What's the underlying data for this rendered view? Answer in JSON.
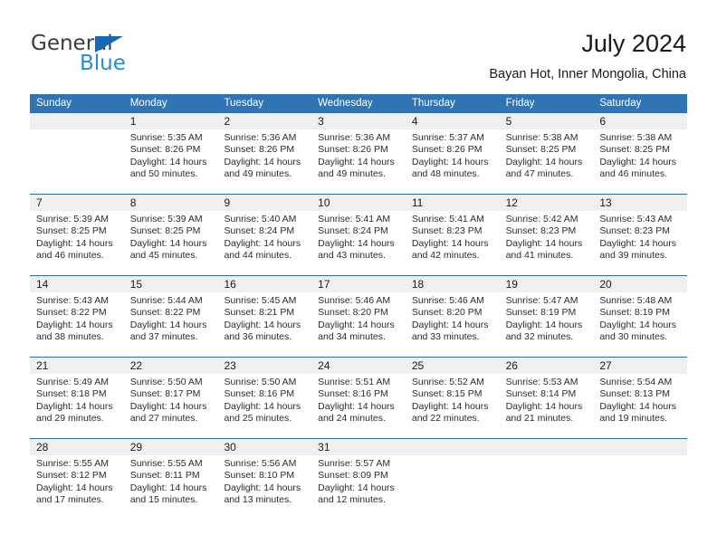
{
  "brand": {
    "name_part1": "General",
    "name_part2": "Blue",
    "triangle_color": "#1667b5",
    "blue_color": "#2a8ad4"
  },
  "header": {
    "title": "July 2024",
    "subtitle": "Bayan Hot, Inner Mongolia, China"
  },
  "theme": {
    "header_blue": "#3174b4",
    "separator_blue": "#2e6da4",
    "number_band_gray": "#efefef"
  },
  "calendar": {
    "weekday_headers": [
      "Sunday",
      "Monday",
      "Tuesday",
      "Wednesday",
      "Thursday",
      "Friday",
      "Saturday"
    ],
    "weeks": [
      {
        "days": [
          {
            "number": "",
            "sunrise": "",
            "sunset": "",
            "daylight_line1": "",
            "daylight_line2": "",
            "empty": true
          },
          {
            "number": "1",
            "sunrise": "Sunrise: 5:35 AM",
            "sunset": "Sunset: 8:26 PM",
            "daylight_line1": "Daylight: 14 hours",
            "daylight_line2": "and 50 minutes.",
            "empty": false
          },
          {
            "number": "2",
            "sunrise": "Sunrise: 5:36 AM",
            "sunset": "Sunset: 8:26 PM",
            "daylight_line1": "Daylight: 14 hours",
            "daylight_line2": "and 49 minutes.",
            "empty": false
          },
          {
            "number": "3",
            "sunrise": "Sunrise: 5:36 AM",
            "sunset": "Sunset: 8:26 PM",
            "daylight_line1": "Daylight: 14 hours",
            "daylight_line2": "and 49 minutes.",
            "empty": false
          },
          {
            "number": "4",
            "sunrise": "Sunrise: 5:37 AM",
            "sunset": "Sunset: 8:26 PM",
            "daylight_line1": "Daylight: 14 hours",
            "daylight_line2": "and 48 minutes.",
            "empty": false
          },
          {
            "number": "5",
            "sunrise": "Sunrise: 5:38 AM",
            "sunset": "Sunset: 8:25 PM",
            "daylight_line1": "Daylight: 14 hours",
            "daylight_line2": "and 47 minutes.",
            "empty": false
          },
          {
            "number": "6",
            "sunrise": "Sunrise: 5:38 AM",
            "sunset": "Sunset: 8:25 PM",
            "daylight_line1": "Daylight: 14 hours",
            "daylight_line2": "and 46 minutes.",
            "empty": false
          }
        ]
      },
      {
        "days": [
          {
            "number": "7",
            "sunrise": "Sunrise: 5:39 AM",
            "sunset": "Sunset: 8:25 PM",
            "daylight_line1": "Daylight: 14 hours",
            "daylight_line2": "and 46 minutes.",
            "empty": false
          },
          {
            "number": "8",
            "sunrise": "Sunrise: 5:39 AM",
            "sunset": "Sunset: 8:25 PM",
            "daylight_line1": "Daylight: 14 hours",
            "daylight_line2": "and 45 minutes.",
            "empty": false
          },
          {
            "number": "9",
            "sunrise": "Sunrise: 5:40 AM",
            "sunset": "Sunset: 8:24 PM",
            "daylight_line1": "Daylight: 14 hours",
            "daylight_line2": "and 44 minutes.",
            "empty": false
          },
          {
            "number": "10",
            "sunrise": "Sunrise: 5:41 AM",
            "sunset": "Sunset: 8:24 PM",
            "daylight_line1": "Daylight: 14 hours",
            "daylight_line2": "and 43 minutes.",
            "empty": false
          },
          {
            "number": "11",
            "sunrise": "Sunrise: 5:41 AM",
            "sunset": "Sunset: 8:23 PM",
            "daylight_line1": "Daylight: 14 hours",
            "daylight_line2": "and 42 minutes.",
            "empty": false
          },
          {
            "number": "12",
            "sunrise": "Sunrise: 5:42 AM",
            "sunset": "Sunset: 8:23 PM",
            "daylight_line1": "Daylight: 14 hours",
            "daylight_line2": "and 41 minutes.",
            "empty": false
          },
          {
            "number": "13",
            "sunrise": "Sunrise: 5:43 AM",
            "sunset": "Sunset: 8:23 PM",
            "daylight_line1": "Daylight: 14 hours",
            "daylight_line2": "and 39 minutes.",
            "empty": false
          }
        ]
      },
      {
        "days": [
          {
            "number": "14",
            "sunrise": "Sunrise: 5:43 AM",
            "sunset": "Sunset: 8:22 PM",
            "daylight_line1": "Daylight: 14 hours",
            "daylight_line2": "and 38 minutes.",
            "empty": false
          },
          {
            "number": "15",
            "sunrise": "Sunrise: 5:44 AM",
            "sunset": "Sunset: 8:22 PM",
            "daylight_line1": "Daylight: 14 hours",
            "daylight_line2": "and 37 minutes.",
            "empty": false
          },
          {
            "number": "16",
            "sunrise": "Sunrise: 5:45 AM",
            "sunset": "Sunset: 8:21 PM",
            "daylight_line1": "Daylight: 14 hours",
            "daylight_line2": "and 36 minutes.",
            "empty": false
          },
          {
            "number": "17",
            "sunrise": "Sunrise: 5:46 AM",
            "sunset": "Sunset: 8:20 PM",
            "daylight_line1": "Daylight: 14 hours",
            "daylight_line2": "and 34 minutes.",
            "empty": false
          },
          {
            "number": "18",
            "sunrise": "Sunrise: 5:46 AM",
            "sunset": "Sunset: 8:20 PM",
            "daylight_line1": "Daylight: 14 hours",
            "daylight_line2": "and 33 minutes.",
            "empty": false
          },
          {
            "number": "19",
            "sunrise": "Sunrise: 5:47 AM",
            "sunset": "Sunset: 8:19 PM",
            "daylight_line1": "Daylight: 14 hours",
            "daylight_line2": "and 32 minutes.",
            "empty": false
          },
          {
            "number": "20",
            "sunrise": "Sunrise: 5:48 AM",
            "sunset": "Sunset: 8:19 PM",
            "daylight_line1": "Daylight: 14 hours",
            "daylight_line2": "and 30 minutes.",
            "empty": false
          }
        ]
      },
      {
        "days": [
          {
            "number": "21",
            "sunrise": "Sunrise: 5:49 AM",
            "sunset": "Sunset: 8:18 PM",
            "daylight_line1": "Daylight: 14 hours",
            "daylight_line2": "and 29 minutes.",
            "empty": false
          },
          {
            "number": "22",
            "sunrise": "Sunrise: 5:50 AM",
            "sunset": "Sunset: 8:17 PM",
            "daylight_line1": "Daylight: 14 hours",
            "daylight_line2": "and 27 minutes.",
            "empty": false
          },
          {
            "number": "23",
            "sunrise": "Sunrise: 5:50 AM",
            "sunset": "Sunset: 8:16 PM",
            "daylight_line1": "Daylight: 14 hours",
            "daylight_line2": "and 25 minutes.",
            "empty": false
          },
          {
            "number": "24",
            "sunrise": "Sunrise: 5:51 AM",
            "sunset": "Sunset: 8:16 PM",
            "daylight_line1": "Daylight: 14 hours",
            "daylight_line2": "and 24 minutes.",
            "empty": false
          },
          {
            "number": "25",
            "sunrise": "Sunrise: 5:52 AM",
            "sunset": "Sunset: 8:15 PM",
            "daylight_line1": "Daylight: 14 hours",
            "daylight_line2": "and 22 minutes.",
            "empty": false
          },
          {
            "number": "26",
            "sunrise": "Sunrise: 5:53 AM",
            "sunset": "Sunset: 8:14 PM",
            "daylight_line1": "Daylight: 14 hours",
            "daylight_line2": "and 21 minutes.",
            "empty": false
          },
          {
            "number": "27",
            "sunrise": "Sunrise: 5:54 AM",
            "sunset": "Sunset: 8:13 PM",
            "daylight_line1": "Daylight: 14 hours",
            "daylight_line2": "and 19 minutes.",
            "empty": false
          }
        ]
      },
      {
        "days": [
          {
            "number": "28",
            "sunrise": "Sunrise: 5:55 AM",
            "sunset": "Sunset: 8:12 PM",
            "daylight_line1": "Daylight: 14 hours",
            "daylight_line2": "and 17 minutes.",
            "empty": false
          },
          {
            "number": "29",
            "sunrise": "Sunrise: 5:55 AM",
            "sunset": "Sunset: 8:11 PM",
            "daylight_line1": "Daylight: 14 hours",
            "daylight_line2": "and 15 minutes.",
            "empty": false
          },
          {
            "number": "30",
            "sunrise": "Sunrise: 5:56 AM",
            "sunset": "Sunset: 8:10 PM",
            "daylight_line1": "Daylight: 14 hours",
            "daylight_line2": "and 13 minutes.",
            "empty": false
          },
          {
            "number": "31",
            "sunrise": "Sunrise: 5:57 AM",
            "sunset": "Sunset: 8:09 PM",
            "daylight_line1": "Daylight: 14 hours",
            "daylight_line2": "and 12 minutes.",
            "empty": false
          },
          {
            "number": "",
            "sunrise": "",
            "sunset": "",
            "daylight_line1": "",
            "daylight_line2": "",
            "empty": true
          },
          {
            "number": "",
            "sunrise": "",
            "sunset": "",
            "daylight_line1": "",
            "daylight_line2": "",
            "empty": true
          },
          {
            "number": "",
            "sunrise": "",
            "sunset": "",
            "daylight_line1": "",
            "daylight_line2": "",
            "empty": true
          }
        ]
      }
    ]
  }
}
